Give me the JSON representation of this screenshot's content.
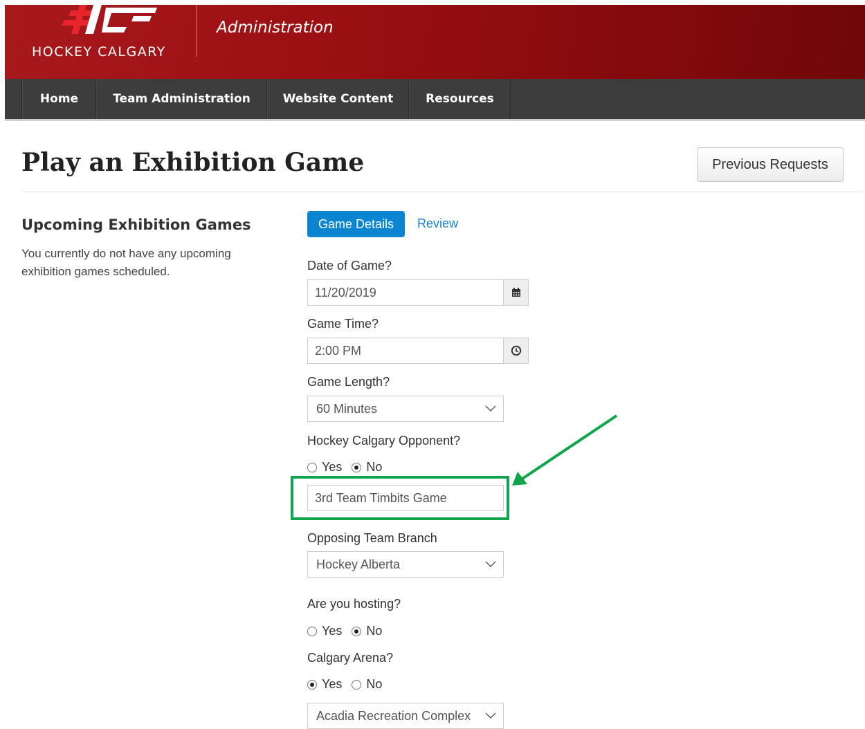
{
  "header": {
    "logo_text": "HOCKEY CALGARY",
    "title": "Administration",
    "brand_color": "#9a0f12"
  },
  "nav": {
    "items": [
      {
        "label": "Home"
      },
      {
        "label": "Team Administration"
      },
      {
        "label": "Website Content"
      },
      {
        "label": "Resources"
      }
    ]
  },
  "page": {
    "title": "Play an Exhibition Game",
    "previous_requests_label": "Previous Requests"
  },
  "sidebar": {
    "heading": "Upcoming Exhibition Games",
    "message": "You currently do not have any upcoming exhibition games scheduled."
  },
  "tabs": {
    "active": "Game Details",
    "next": "Review",
    "active_color": "#0a86d1"
  },
  "form": {
    "date": {
      "label": "Date of Game?",
      "value": "11/20/2019",
      "icon": "calendar-icon"
    },
    "time": {
      "label": "Game Time?",
      "value": "2:00 PM",
      "icon": "clock-icon"
    },
    "length": {
      "label": "Game Length?",
      "value": "60 Minutes"
    },
    "hc_opponent": {
      "label": "Hockey Calgary Opponent?",
      "yes": "Yes",
      "no": "No",
      "selected": "No"
    },
    "opponent_name": {
      "value": "3rd Team Timbits Game"
    },
    "branch": {
      "label": "Opposing Team Branch",
      "value": "Hockey Alberta"
    },
    "hosting": {
      "label": "Are you hosting?",
      "yes": "Yes",
      "no": "No",
      "selected": "No"
    },
    "calgary_arena": {
      "label": "Calgary Arena?",
      "yes": "Yes",
      "no": "No",
      "selected": "Yes"
    },
    "arena": {
      "value": "Acadia Recreation Complex"
    }
  },
  "annotation": {
    "color": "#10a54a"
  }
}
